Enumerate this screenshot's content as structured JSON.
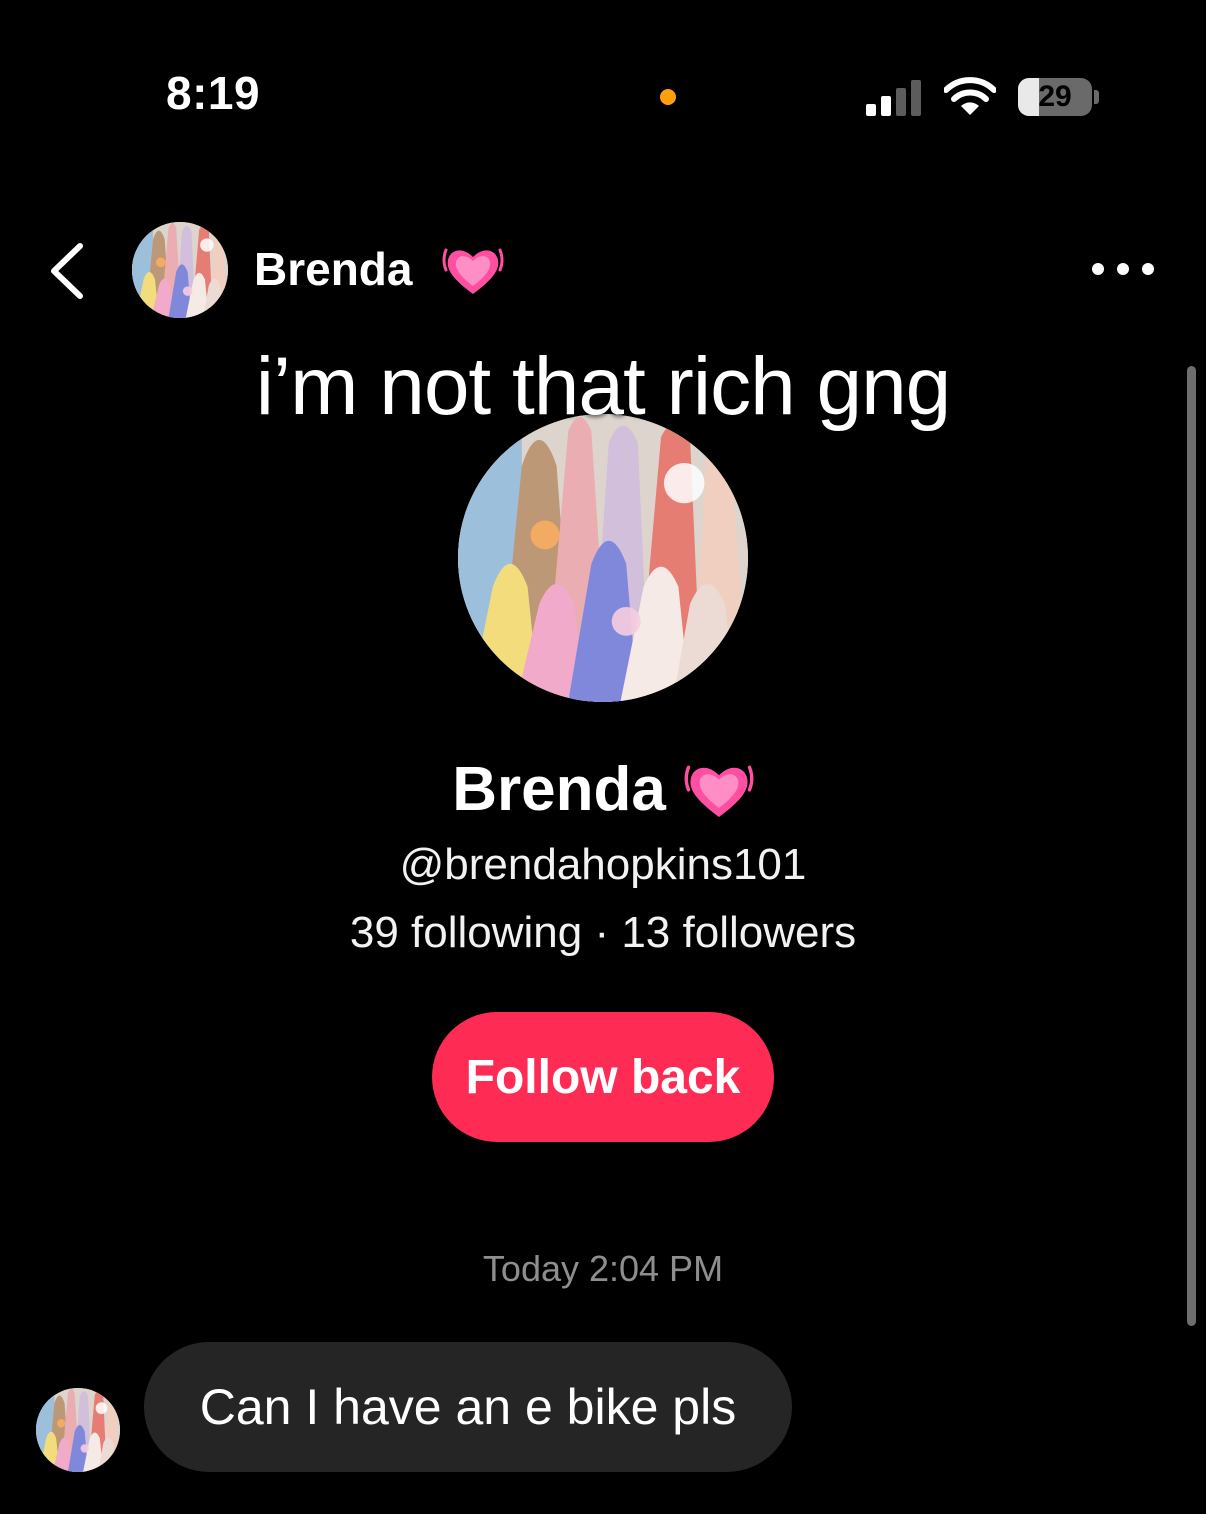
{
  "status_bar": {
    "time": "8:19",
    "battery_level": "29",
    "battery_fraction": 0.29,
    "signal_bars_active": 2,
    "mic_indicator_color": "#ff9f0a"
  },
  "header": {
    "contact_name": "Brenda",
    "back_icon": "chevron-left-icon",
    "more_icon": "ellipsis-icon",
    "name_emoji_icon": "growing-heart-icon"
  },
  "overlay_caption": "i’m not that rich gng",
  "profile": {
    "name": "Brenda",
    "handle": "@brendahopkins101",
    "stats": "39 following · 13 followers",
    "follow_back_label": "Follow back"
  },
  "chat": {
    "timestamp": "Today 2:04 PM",
    "messages": [
      {
        "sender": "Brenda",
        "text": "Can I have an e bike pls"
      }
    ]
  },
  "colors": {
    "background": "#000000",
    "follow_button": "#fe2c55",
    "bubble": "#252525",
    "heart": "#ff4fa3"
  }
}
